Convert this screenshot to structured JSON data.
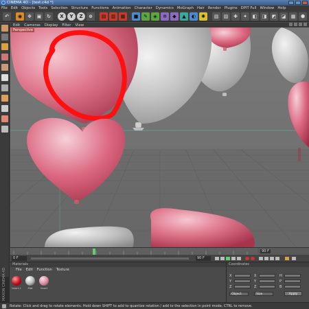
{
  "window": {
    "title": "CINEMA 4D - [test.c4d *]"
  },
  "menu": [
    "File",
    "Edit",
    "Objects",
    "Tools",
    "Selection",
    "Structure",
    "Functions",
    "Animation",
    "Character",
    "Dynamics",
    "MoGraph",
    "Hair",
    "Render",
    "Plugins",
    "DPIT Full",
    "Window",
    "Help"
  ],
  "toolbar": {
    "axis_x": "X",
    "axis_y": "Y",
    "axis_z": "Z"
  },
  "viewport": {
    "menu": [
      "Edit",
      "Cameras",
      "Display",
      "Filter",
      "View"
    ],
    "label": "Perspective"
  },
  "timeline": {
    "current_frame": "90 F"
  },
  "transport": {
    "start_field": "0 F",
    "end_field": "90 F"
  },
  "materials": {
    "panel_title": "Materials",
    "menu": [
      "File",
      "Edit",
      "Function",
      "Texture"
    ],
    "items": [
      "heart.1",
      "Mat",
      "heart"
    ]
  },
  "coordinates": {
    "panel_title": "Coordinates",
    "position_labels": [
      "X",
      "Y",
      "Z"
    ],
    "size_labels": [
      "X",
      "Y",
      "Z"
    ],
    "rotation_labels": [
      "H",
      "P",
      "B"
    ],
    "mode_dropdown": "Object",
    "size_dropdown": "Size",
    "apply_label": "Apply"
  },
  "brand": {
    "vertical_text": "MAXON CINEMA 4D"
  },
  "status": {
    "text": "Rotate: Click and drag to rotate elements. Hold down SHIFT to add to quantize rotation / add to the selection in point mode, CTRL to remove."
  },
  "colors": {
    "heart_pink": "#d9627a",
    "balloon_gray": "#cfcfcf",
    "annotation_red": "#ff1010",
    "menu_bg": "#3a3a3a"
  }
}
